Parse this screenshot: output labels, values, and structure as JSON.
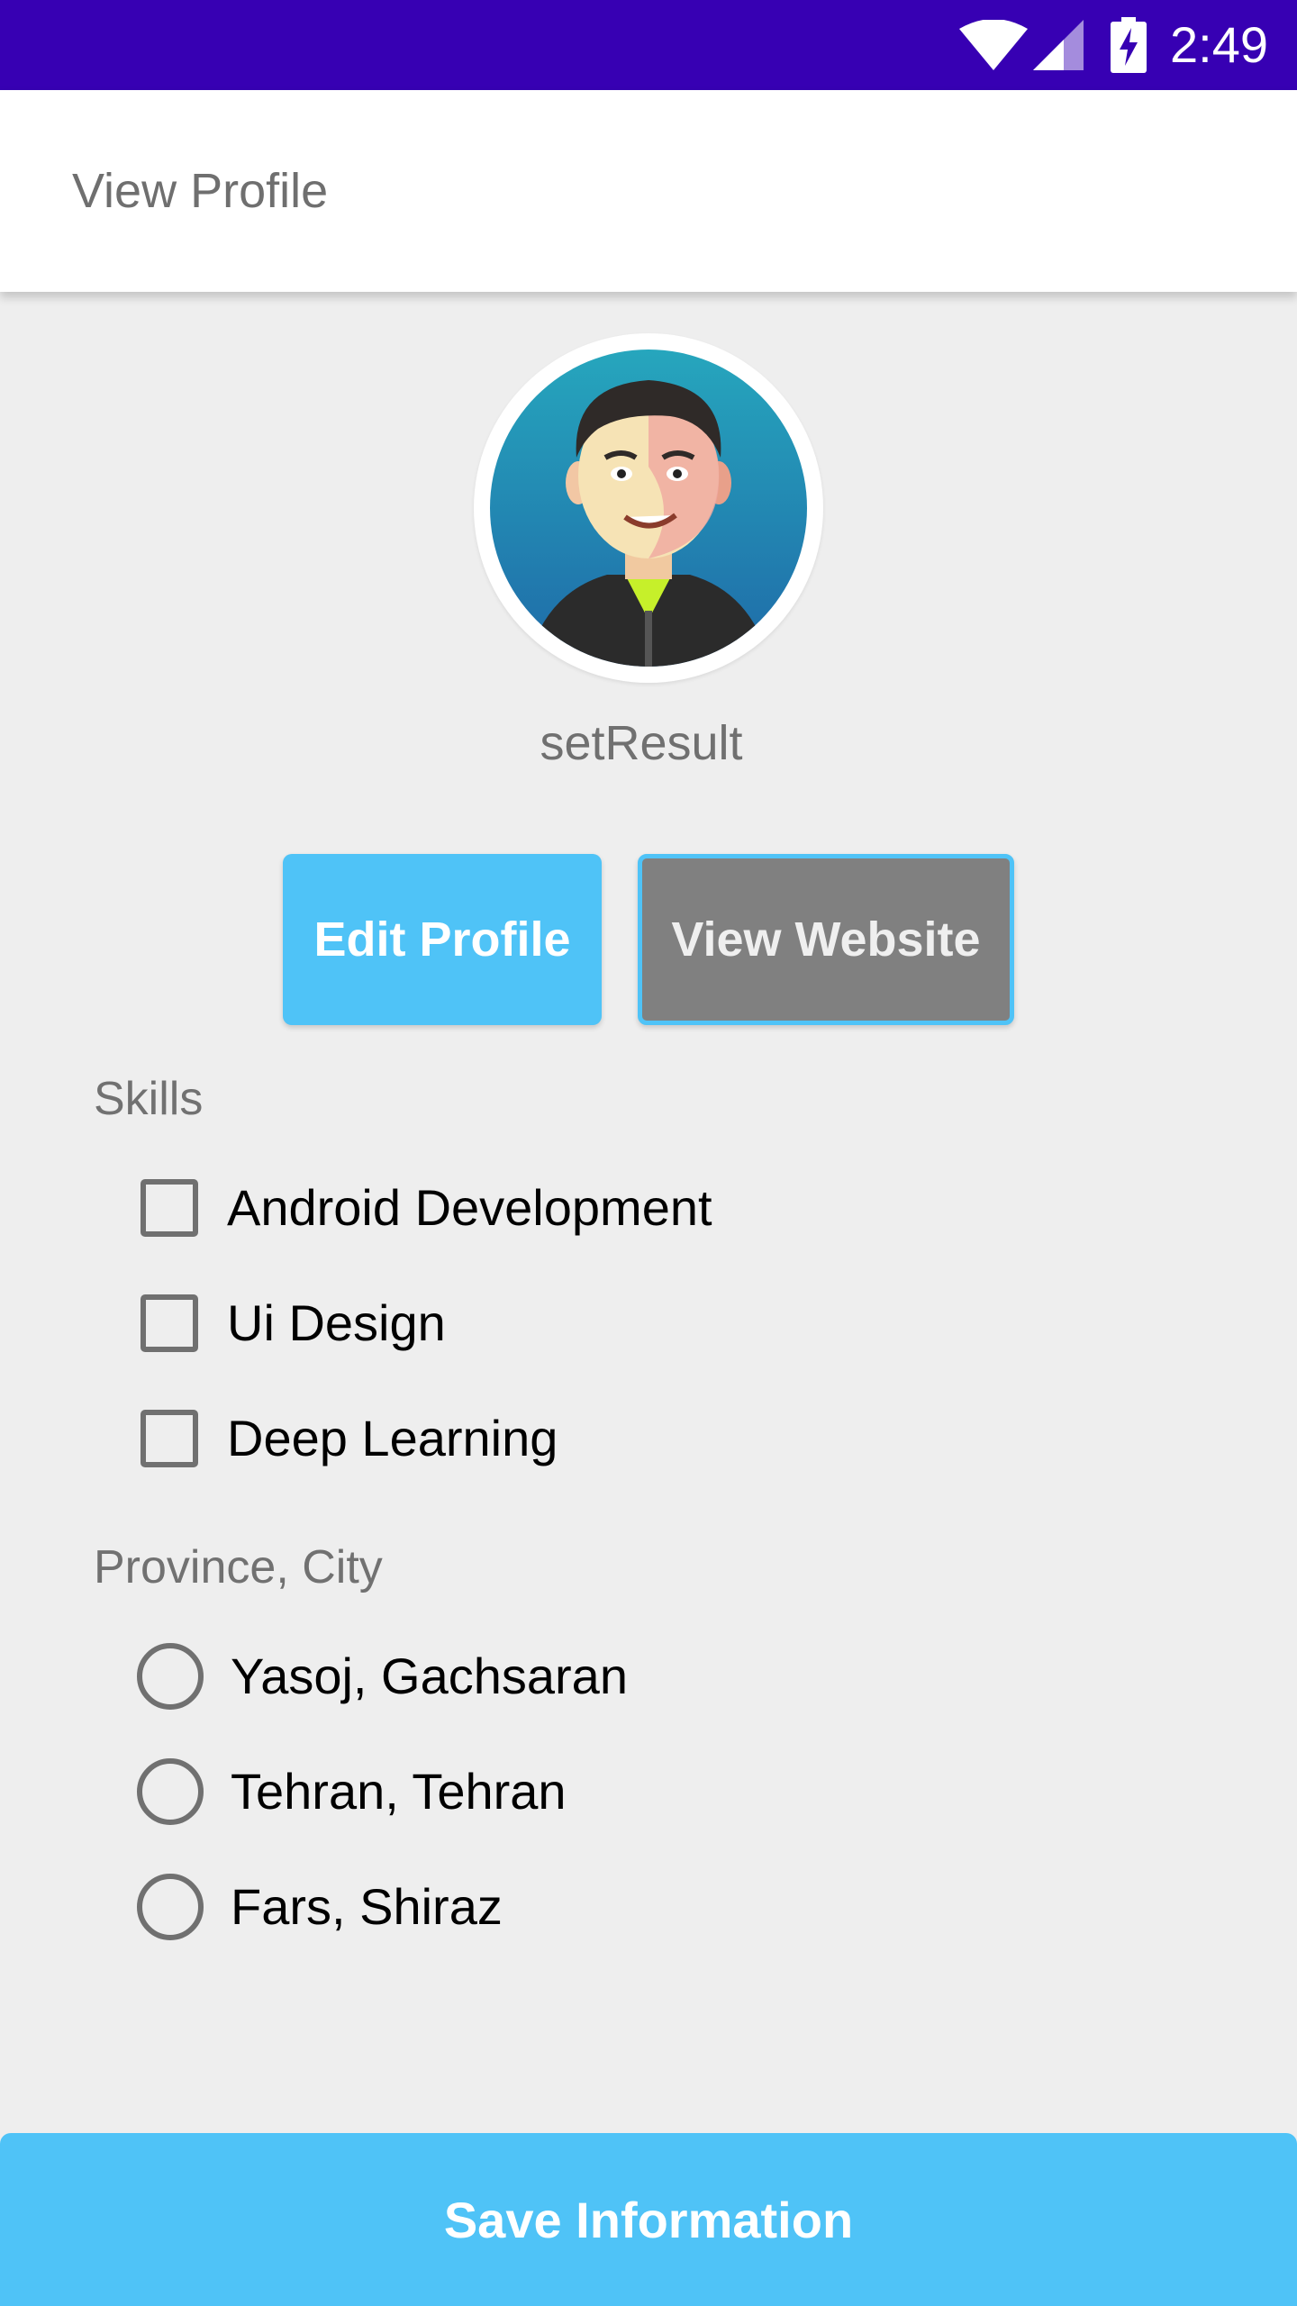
{
  "status_bar": {
    "time": "2:49",
    "icons": [
      "wifi-icon",
      "cellular-signal-icon",
      "battery-charging-icon"
    ],
    "background": "#3700b3"
  },
  "app_bar": {
    "title": "View Profile"
  },
  "profile": {
    "avatar": "avatar-illustration",
    "username": "setResult"
  },
  "actions": {
    "edit_label": "Edit Profile",
    "website_label": "View Website"
  },
  "skills": {
    "title": "Skills",
    "items": [
      {
        "label": "Android Development",
        "checked": false
      },
      {
        "label": "Ui Design",
        "checked": false
      },
      {
        "label": "Deep Learning",
        "checked": false
      }
    ]
  },
  "location": {
    "title": "Province, City",
    "options": [
      {
        "label": "Yasoj, Gachsaran",
        "selected": false
      },
      {
        "label": "Tehran, Tehran",
        "selected": false
      },
      {
        "label": "Fars, Shiraz",
        "selected": false
      }
    ]
  },
  "footer": {
    "save_label": "Save Information"
  },
  "colors": {
    "accent": "#4fc3f7",
    "primary_dark": "#3700b3",
    "background": "#eeeeee",
    "button_gray": "#808080"
  }
}
